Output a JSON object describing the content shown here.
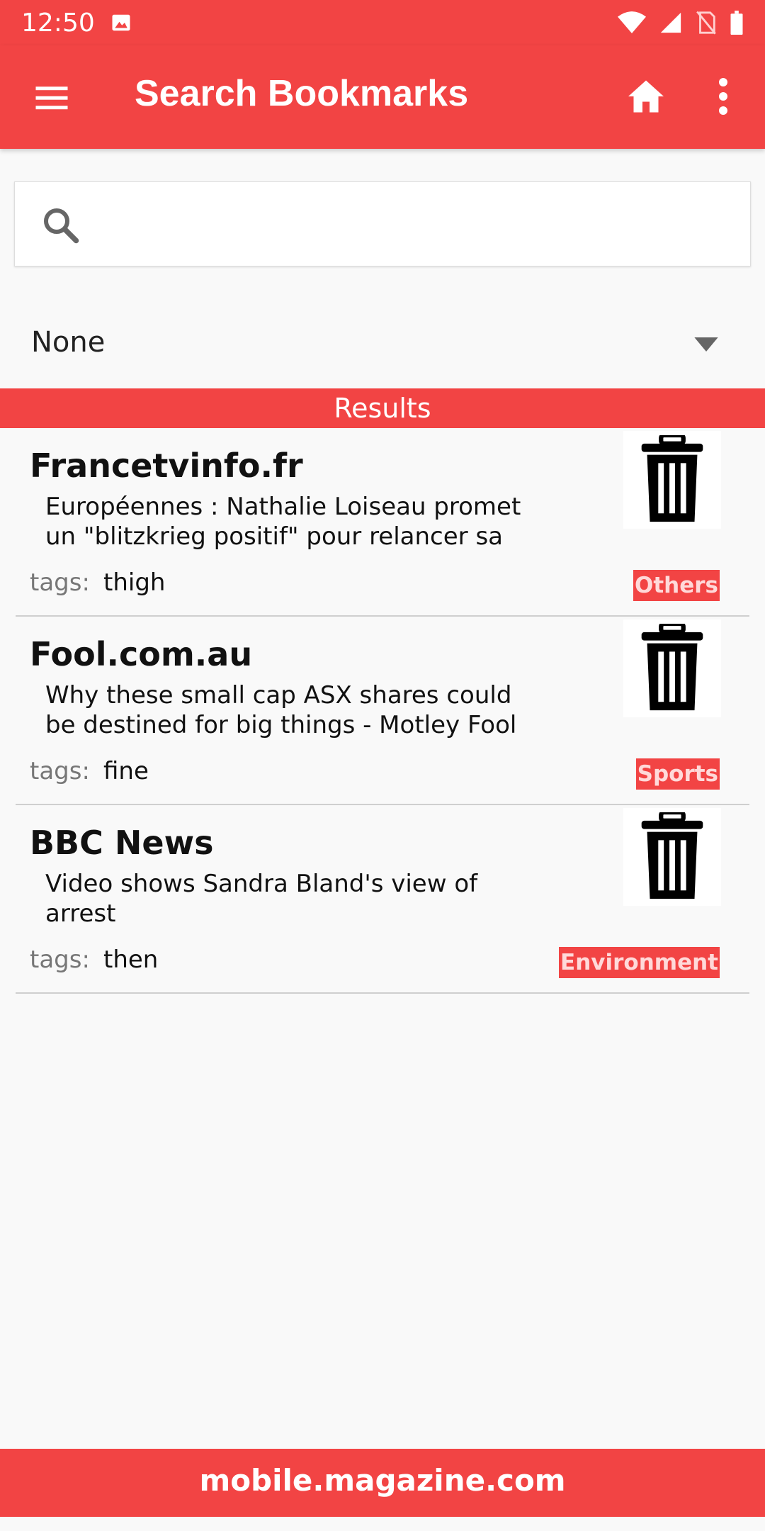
{
  "status_bar": {
    "time": "12:50"
  },
  "toolbar": {
    "title": "Search Bookmarks"
  },
  "search": {
    "value": "",
    "placeholder": ""
  },
  "filter": {
    "selected": "None"
  },
  "results": {
    "header": "Results",
    "tags_label": "tags:",
    "items": [
      {
        "site": "Francetvinfo.fr",
        "description": "Européennes : Nathalie Loiseau promet un \"blitzkrieg positif\" pour relancer sa",
        "tags": "thigh",
        "category": "Others"
      },
      {
        "site": "Fool.com.au",
        "description": "Why these small cap ASX shares could be destined for big things - Motley Fool Australia",
        "tags": "fine",
        "category": "Sports"
      },
      {
        "site": "BBC News",
        "description": "Video shows Sandra Bland's view of arrest",
        "tags": "then",
        "category": "Environment"
      }
    ]
  },
  "footer": {
    "text": "mobile.magazine.com"
  },
  "colors": {
    "accent": "#f24444",
    "background": "#f9f9f9"
  }
}
